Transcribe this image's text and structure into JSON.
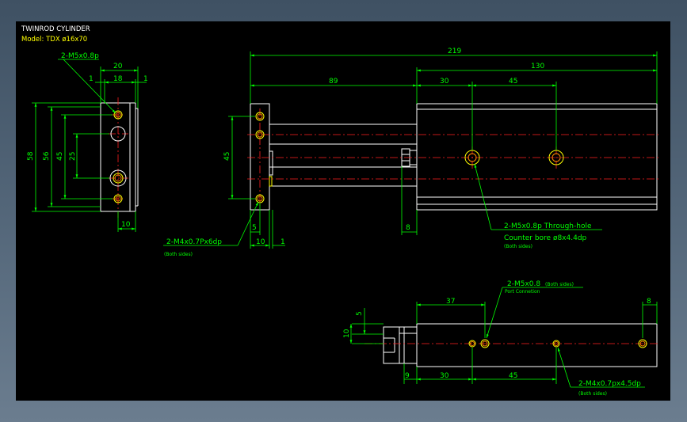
{
  "title": "TWINROD CYLINDER",
  "model": "Model: TDX ø16x70",
  "colors": {
    "outline": "#ffffff",
    "dimension": "#00ff00",
    "centerline": "#ff2020",
    "hole": "#ffff00",
    "background": "#000000"
  },
  "end_view": {
    "d_58": "58",
    "d_56": "56",
    "d_45": "45",
    "d_25": "25",
    "d_20": "20",
    "d_18": "18",
    "d_1a": "1",
    "d_1b": "1",
    "d_10": "10",
    "note_m5": "2-M5x0.8p"
  },
  "side_view": {
    "d_219": "219",
    "d_130": "130",
    "d_89": "89",
    "d_30": "30",
    "d_45top": "45",
    "d_45": "45",
    "d_5": "5",
    "d_10": "10",
    "d_1": "1",
    "d_8": "8",
    "note_m4": "2-M4x0.7Px6dp",
    "note_m4_sub": "(Both sides)",
    "note_through": "2-M5x0.8p Through-hole",
    "note_counter": "Counter bore ø8x4.4dp",
    "note_through_sub": "(Both sides)"
  },
  "bottom_view": {
    "d_37": "37",
    "d_8": "8",
    "d_5": "5",
    "d_10": "10",
    "d_9": "9",
    "d_30": "30",
    "d_45": "45",
    "note_port": "2-M5x0.8",
    "note_port_both": "(Both sides)",
    "note_port_sub": "Port Connetion",
    "note_m4": "2-M4x0.7px4.5dp",
    "note_m4_sub": "(Both sides)"
  }
}
